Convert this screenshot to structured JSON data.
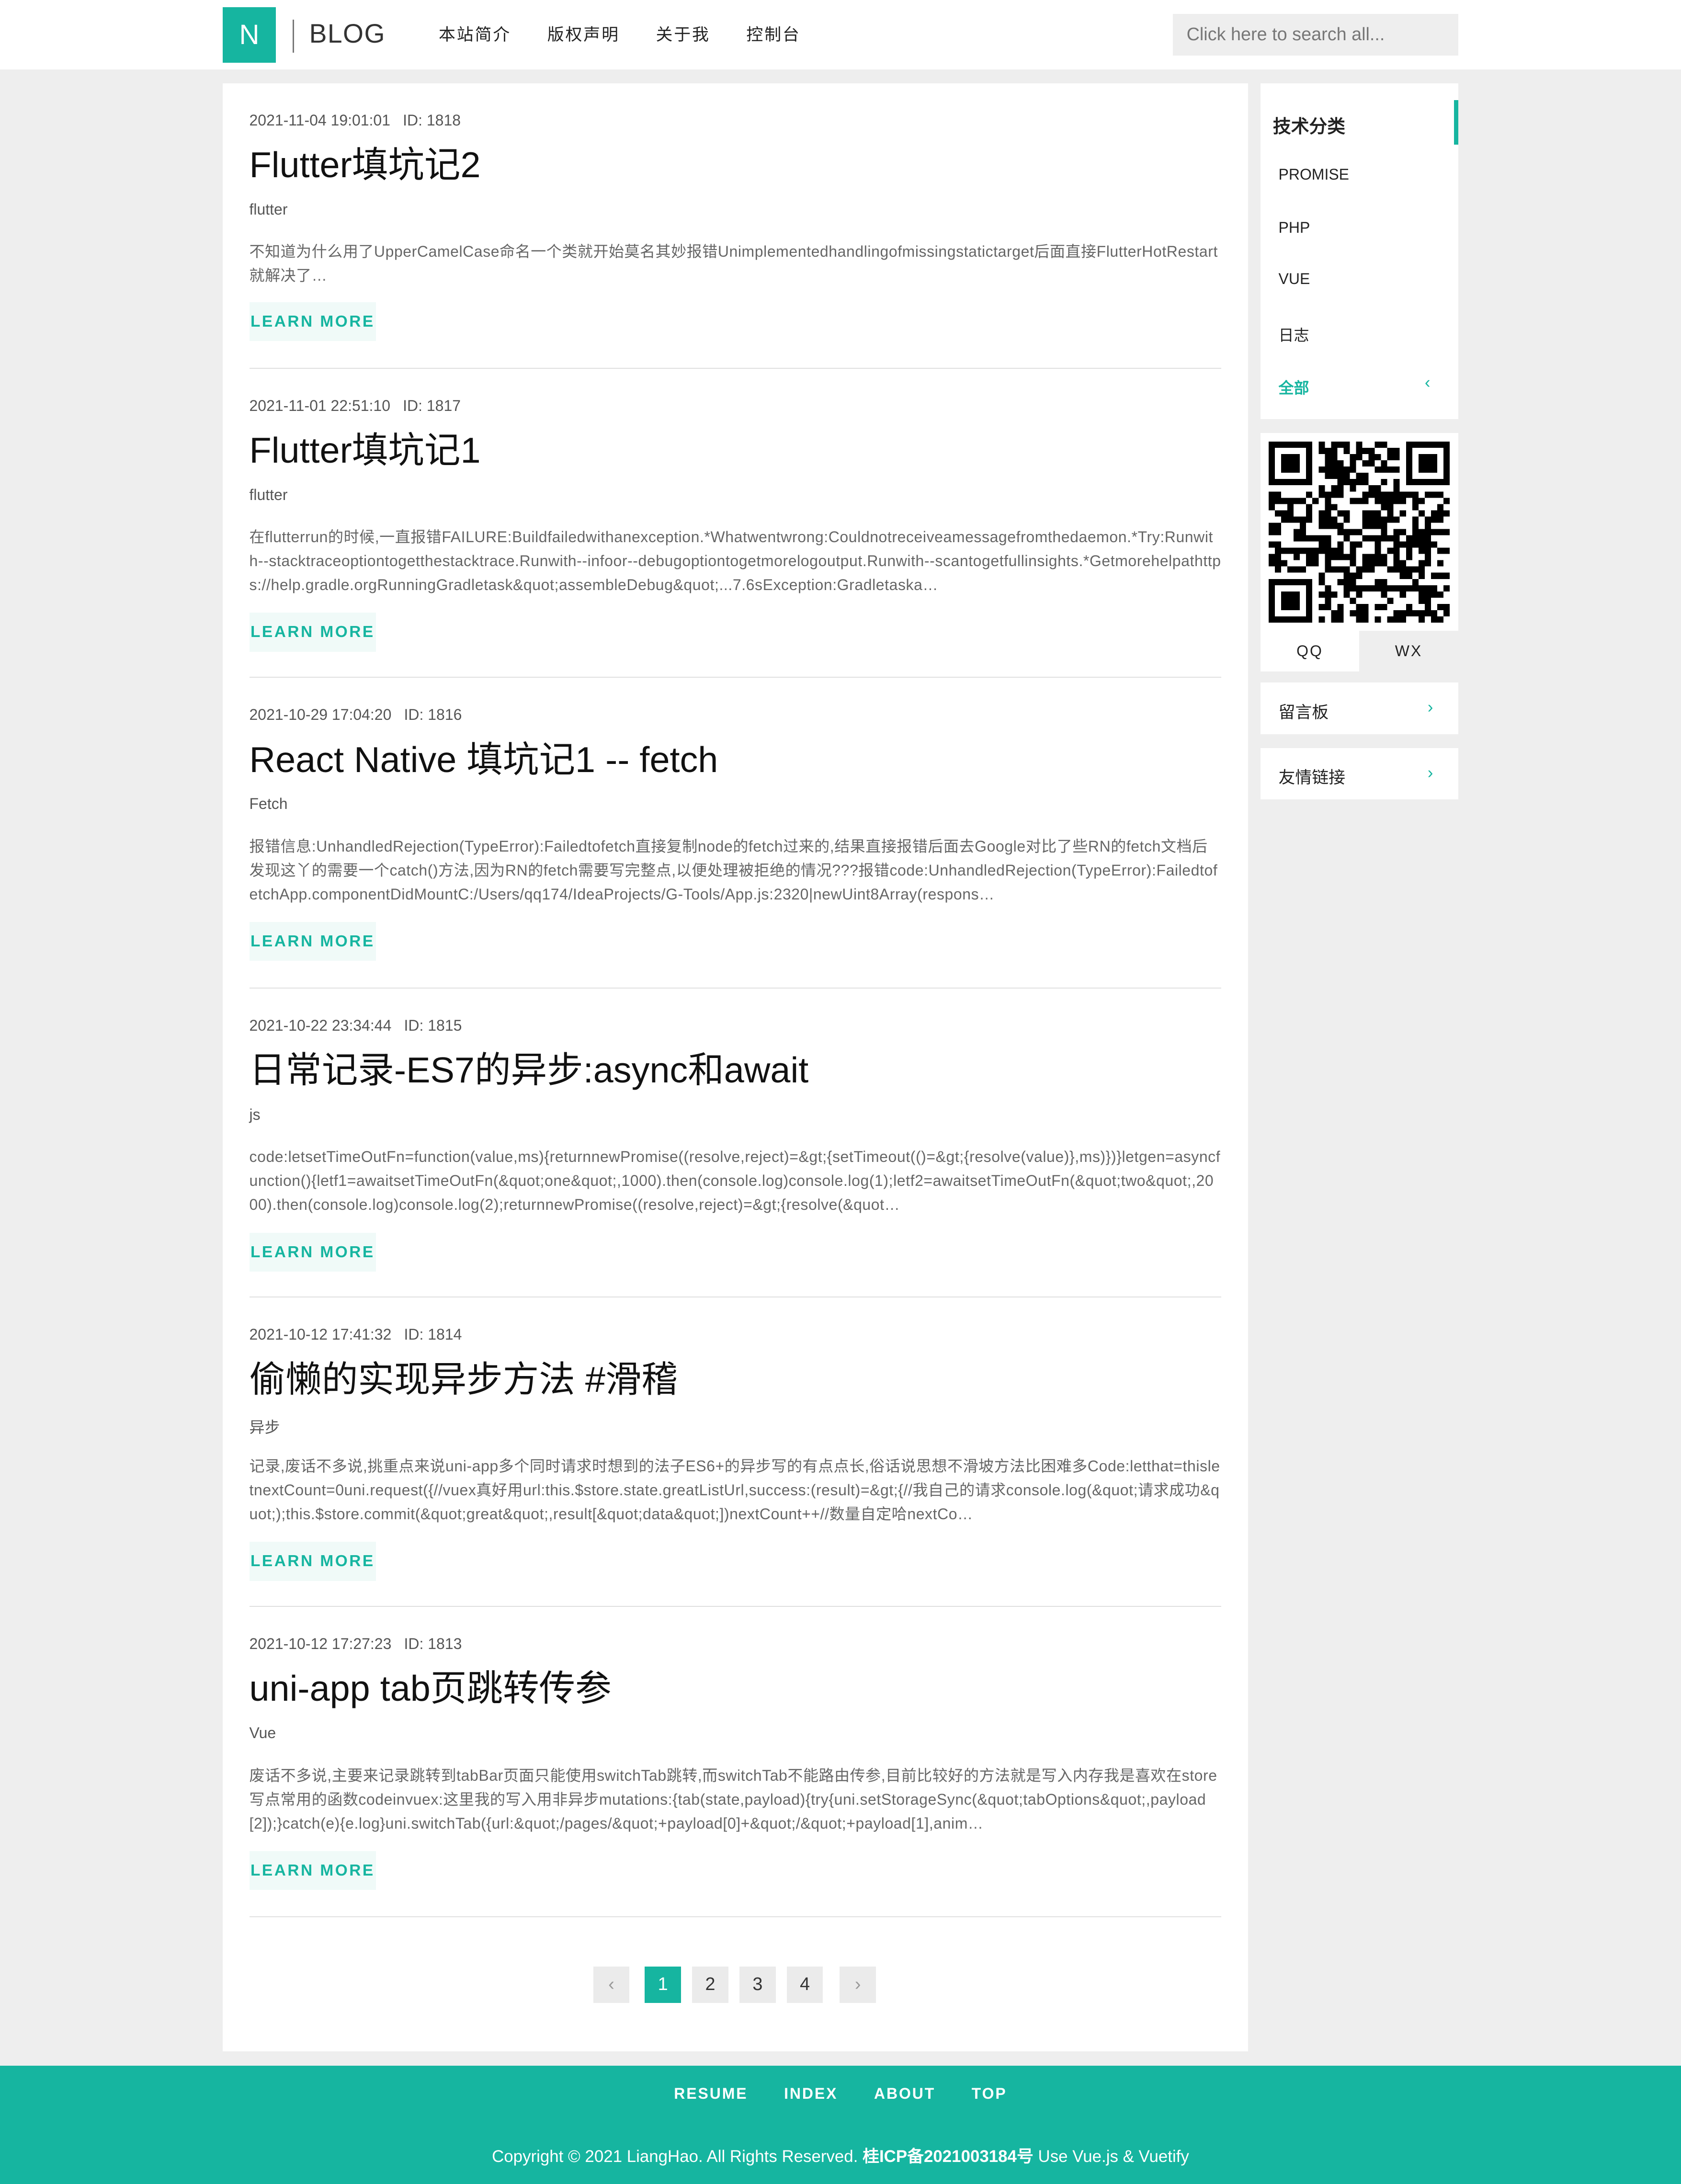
{
  "header": {
    "logo_letter": "N",
    "brand": "BLOG",
    "nav": [
      "本站简介",
      "版权声明",
      "关于我",
      "控制台"
    ],
    "search_placeholder": "Click here to search all..."
  },
  "posts": [
    {
      "date": "2021-11-04 19:01:01",
      "id": "ID: 1818",
      "title": "Flutter填坑记2",
      "tag": "flutter",
      "excerpt": "不知道为什么用了UpperCamelCase命名一个类就开始莫名其妙报错Unimplementedhandlingofmissingstatictarget后面直接FlutterHotRestart就解决了…",
      "cta": "LEARN MORE"
    },
    {
      "date": "2021-11-01 22:51:10",
      "id": "ID: 1817",
      "title": "Flutter填坑记1",
      "tag": "flutter",
      "excerpt": "在flutterrun的时候,一直报错FAILURE:Buildfailedwithanexception.*Whatwentwrong:Couldnotreceiveamessagefromthedaemon.*Try:Runwith--stacktraceoptiontogetthestacktrace.Runwith--infoor--debugoptiontogetmorelogoutput.Runwith--scantogetfullinsights.*Getmorehelpathttps://help.gradle.orgRunningGradletask&quot;assembleDebug&quot;...7.6sException:Gradletaska…",
      "cta": "LEARN MORE"
    },
    {
      "date": "2021-10-29 17:04:20",
      "id": "ID: 1816",
      "title": "React Native 填坑记1 -- fetch",
      "tag": "Fetch",
      "excerpt": "报错信息:UnhandledRejection(TypeError):Failedtofetch直接复制node的fetch过来的,结果直接报错后面去Google对比了些RN的fetch文档后发现这丫的需要一个catch()方法,因为RN的fetch需要写完整点,以便处理被拒绝的情况???报错code:UnhandledRejection(TypeError):FailedtofetchApp.componentDidMountC:/Users/qq174/IdeaProjects/G-Tools/App.js:2320|newUint8Array(respons…",
      "cta": "LEARN MORE"
    },
    {
      "date": "2021-10-22 23:34:44",
      "id": "ID: 1815",
      "title": "日常记录-ES7的异步:async和await",
      "tag": "js",
      "excerpt": "code:letsetTimeOutFn=function(value,ms){returnnewPromise((resolve,reject)=&gt;{setTimeout(()=&gt;{resolve(value)},ms)})}letgen=asyncfunction(){letf1=awaitsetTimeOutFn(&quot;one&quot;,1000).then(console.log)console.log(1);letf2=awaitsetTimeOutFn(&quot;two&quot;,2000).then(console.log)console.log(2);returnnewPromise((resolve,reject)=&gt;{resolve(&quot…",
      "cta": "LEARN MORE"
    },
    {
      "date": "2021-10-12 17:41:32",
      "id": "ID: 1814",
      "title": "偷懒的实现异步方法 #滑稽",
      "tag": "异步",
      "excerpt": "记录,废话不多说,挑重点来说uni-app多个同时请求时想到的法子ES6+的异步写的有点点长,俗话说思想不滑坡方法比困难多Code:letthat=thisletnextCount=0uni.request({//vuex真好用url:this.$store.state.greatListUrl,success:(result)=&gt;{//我自己的请求console.log(&quot;请求成功&quot;);this.$store.commit(&quot;great&quot;,result[&quot;data&quot;])nextCount++//数量自定哈nextCo…",
      "cta": "LEARN MORE"
    },
    {
      "date": "2021-10-12 17:27:23",
      "id": "ID: 1813",
      "title": "uni-app tab页跳转传参",
      "tag": "Vue",
      "excerpt": "废话不多说,主要来记录跳转到tabBar页面只能使用switchTab跳转,而switchTab不能路由传参,目前比较好的方法就是写入内存我是喜欢在store写点常用的函数codeinvuex:这里我的写入用非异步mutations:{tab(state,payload){try{uni.setStorageSync(&quot;tabOptions&quot;,payload[2]);}catch(e){e.log}uni.switchTab({url:&quot;/pages/&quot;+payload[0]+&quot;/&quot;+payload[1],anim…",
      "cta": "LEARN MORE"
    }
  ],
  "pagination": {
    "prev": "‹",
    "pages": [
      "1",
      "2",
      "3",
      "4"
    ],
    "current": "1",
    "next": "›"
  },
  "sidebar": {
    "category_title": "技术分类",
    "categories": [
      "PROMISE",
      "PHP",
      "VUE",
      "日志",
      "全部"
    ],
    "active_category": "全部",
    "qr_tabs": [
      "QQ",
      "WX"
    ],
    "links": [
      "留言板",
      "友情链接"
    ]
  },
  "footer": {
    "nav": [
      "RESUME",
      "INDEX",
      "ABOUT",
      "TOP"
    ],
    "copyright_prefix": "Copyright © 2021 LiangHao. All Rights Reserved.",
    "icp": "桂ICP备2021003184号",
    "copyright_suffix": "Use Vue.js & Vuetify"
  },
  "colors": {
    "accent": "#16b5a0",
    "background": "#eeeeee",
    "card": "#ffffff"
  }
}
